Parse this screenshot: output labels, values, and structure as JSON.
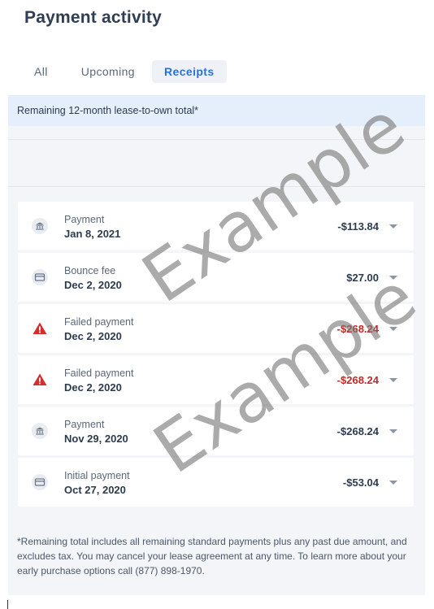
{
  "page": {
    "title": "Payment activity"
  },
  "tabs": [
    {
      "label": "All",
      "active": false
    },
    {
      "label": "Upcoming",
      "active": false
    },
    {
      "label": "Receipts",
      "active": true
    }
  ],
  "banner": {
    "text": "Remaining 12-month lease-to-own total*"
  },
  "transactions": [
    {
      "label": "Payment",
      "date": "Jan 8, 2021",
      "amount": "-$113.84",
      "icon": "bank-icon",
      "negative_red": false
    },
    {
      "label": "Bounce fee",
      "date": "Dec 2, 2020",
      "amount": "$27.00",
      "icon": "card-icon",
      "negative_red": false
    },
    {
      "label": "Failed payment",
      "date": "Dec 2, 2020",
      "amount": "-$268.24",
      "icon": "warning-icon",
      "negative_red": true
    },
    {
      "label": "Failed payment",
      "date": "Dec 2, 2020",
      "amount": "-$268.24",
      "icon": "warning-icon",
      "negative_red": true
    },
    {
      "label": "Payment",
      "date": "Nov 29, 2020",
      "amount": "-$268.24",
      "icon": "bank-icon",
      "negative_red": false
    },
    {
      "label": "Initial payment",
      "date": "Oct 27, 2020",
      "amount": "-$53.04",
      "icon": "card-icon",
      "negative_red": false
    }
  ],
  "footnote": "*Remaining total includes all remaining standard payments plus any past due amount, and excludes tax. You may cancel your lease agreement at any time. To learn more about your early purchase options call (877) 898-1970.",
  "watermark": "Example",
  "colors": {
    "accent": "#2a72d8",
    "failed_amount": "#c62828",
    "warning_icon": "#d32f2f",
    "panel_bg": "#f3f5f8",
    "banner_bg": "#e5eefb"
  }
}
